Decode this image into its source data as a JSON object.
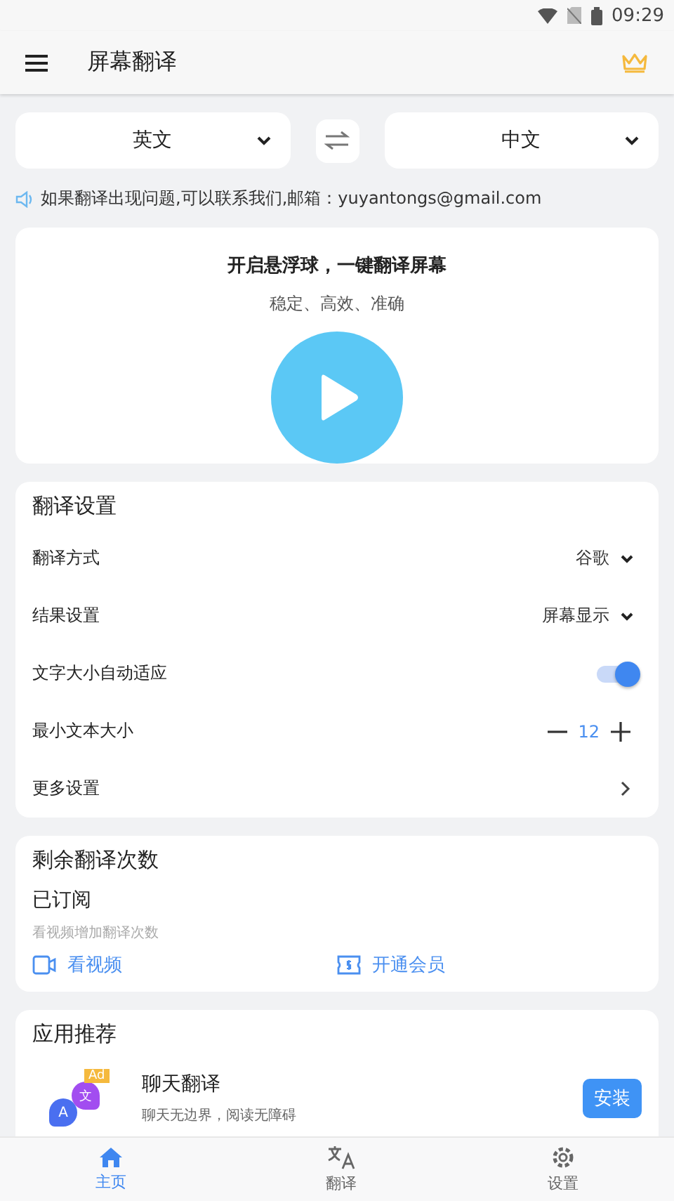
{
  "status_bar": {
    "time": "09:29"
  },
  "app_bar": {
    "title": "屏幕翻译"
  },
  "languages": {
    "source": "英文",
    "target": "中文"
  },
  "notice": "如果翻译出现问题,可以联系我们,邮箱：yuyantongs@gmail.com",
  "float_card": {
    "title": "开启悬浮球，一键翻译屏幕",
    "subtitle": "稳定、高效、准确"
  },
  "settings": {
    "title": "翻译设置",
    "rows": [
      {
        "kind": "select",
        "label": "翻译方式",
        "value": "谷歌"
      },
      {
        "kind": "select",
        "label": "结果设置",
        "value": "屏幕显示"
      },
      {
        "kind": "toggle",
        "label": "文字大小自动适应",
        "on": true
      },
      {
        "kind": "stepper",
        "label": "最小文本大小",
        "value": "12"
      },
      {
        "kind": "link",
        "label": "更多设置"
      }
    ]
  },
  "quota": {
    "title": "剩余翻译次数",
    "status": "已订阅",
    "hint": "看视频增加翻译次数",
    "actions": [
      {
        "kind": "video",
        "label": "看视频"
      },
      {
        "kind": "vip",
        "label": "开通会员"
      }
    ]
  },
  "recommend": {
    "title": "应用推荐",
    "apps": [
      {
        "name": "聊天翻译",
        "description": "聊天无边界，阅读无障碍",
        "badge": "Ad",
        "icon_letters": [
          "A",
          "文"
        ],
        "button": "安装"
      }
    ]
  },
  "bottom_nav": [
    {
      "kind": "home",
      "label": "主页",
      "selected": true
    },
    {
      "kind": "translate",
      "label": "翻译",
      "selected": false
    },
    {
      "kind": "settings",
      "label": "设置",
      "selected": false
    }
  ]
}
